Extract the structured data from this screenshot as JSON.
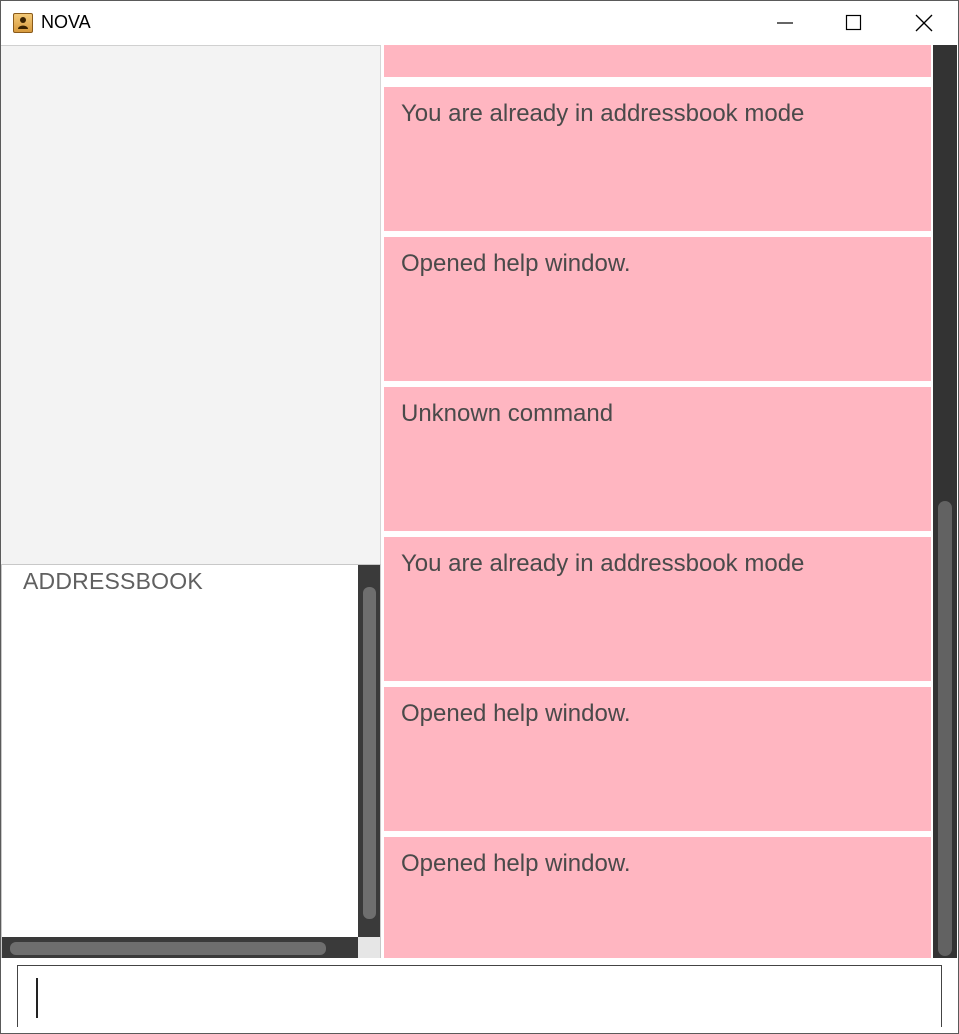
{
  "window": {
    "title": "NOVA",
    "app_icon": "address-book-icon"
  },
  "address_list": {
    "label": "ADDRESSBOOK"
  },
  "results": {
    "messages": [
      "",
      "You are already in addressbook mode",
      "Opened help window.",
      "Unknown command",
      "You are already in addressbook mode",
      "Opened help window.",
      "Opened help window."
    ]
  },
  "command": {
    "value": ""
  },
  "colors": {
    "result_card": "#ffb6c1",
    "scrollbar_track": "#333333",
    "scrollbar_thumb": "#626262"
  }
}
